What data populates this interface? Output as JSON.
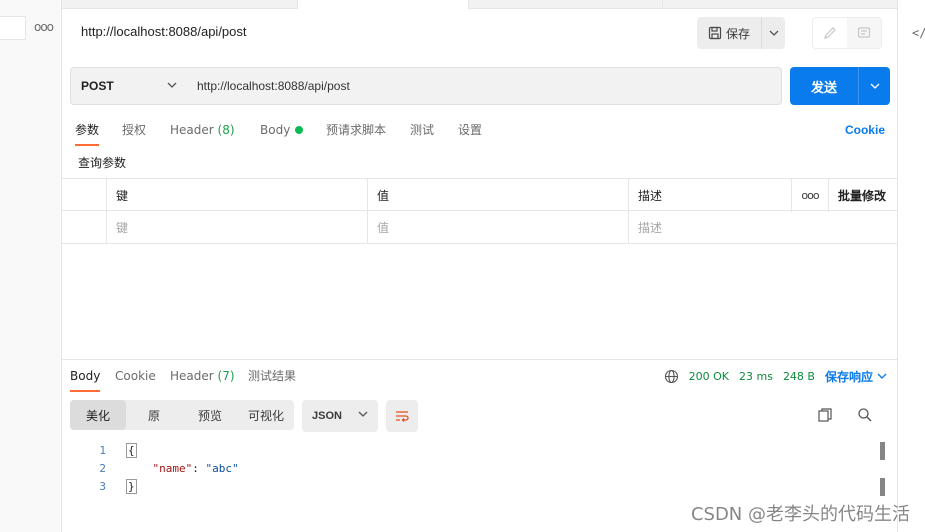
{
  "request": {
    "title": "http://localhost:8088/api/post",
    "save_label": "保存",
    "method": "POST",
    "url": "http://localhost:8088/api/post",
    "send_label": "发送"
  },
  "request_tabs": {
    "params": "参数",
    "auth": "授权",
    "header": "Header",
    "header_count": "(8)",
    "body": "Body",
    "pre_script": "预请求脚本",
    "tests": "测试",
    "settings": "设置",
    "cookie": "Cookie"
  },
  "params": {
    "section_title": "查询参数",
    "col_key": "键",
    "col_value": "值",
    "col_desc": "描述",
    "bulk_edit": "批量修改",
    "placeholder_key": "键",
    "placeholder_value": "值",
    "placeholder_desc": "描述"
  },
  "response_tabs": {
    "body": "Body",
    "cookie": "Cookie",
    "header": "Header",
    "header_count": "(7)",
    "test_results": "测试结果"
  },
  "response_status": {
    "status": "200 OK",
    "time": "23 ms",
    "size": "248 B",
    "save_response": "保存响应"
  },
  "view_modes": {
    "pretty": "美化",
    "raw": "原",
    "preview": "预览",
    "visualize": "可视化",
    "format": "JSON"
  },
  "response_body": {
    "lines": [
      {
        "num": "1",
        "open": "{"
      },
      {
        "num": "2",
        "key": "\"name\"",
        "sep": ": ",
        "value": "\"abc\""
      },
      {
        "num": "3",
        "close": "}"
      }
    ]
  },
  "watermark": "CSDN @老李头的代码生活",
  "colors": {
    "accent": "#ff6c37",
    "primary": "#097bed",
    "success": "#0f8a3c"
  }
}
